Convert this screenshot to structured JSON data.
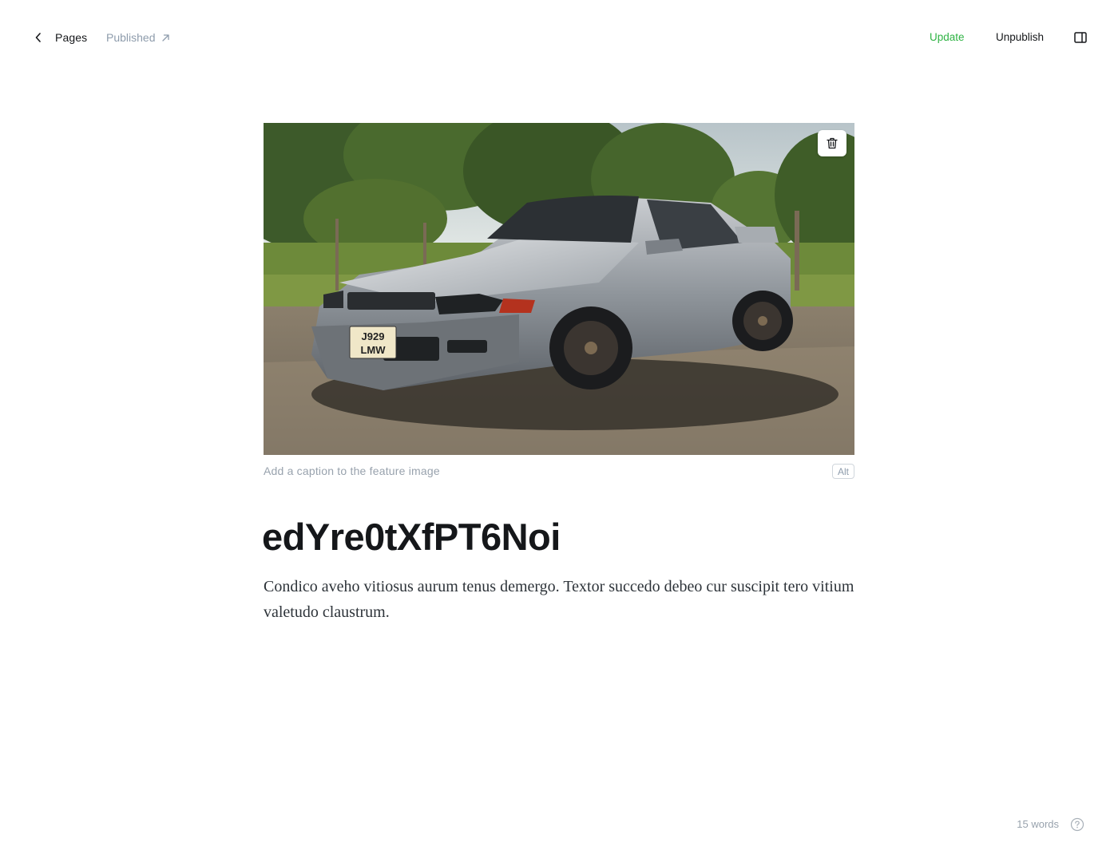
{
  "header": {
    "back_label": "Pages",
    "status_label": "Published",
    "update_label": "Update",
    "unpublish_label": "Unpublish"
  },
  "feature_image": {
    "caption_placeholder": "Add a caption to the feature image",
    "alt_label": "Alt",
    "plate_line1": "J929",
    "plate_line2": "LMW"
  },
  "post": {
    "title": "edYre0tXfPT6Noi",
    "body": "Condico aveho vitiosus aurum tenus demergo. Textor succedo debeo cur suscipit tero vitium valetudo claustrum."
  },
  "footer": {
    "word_count": "15 words"
  },
  "colors": {
    "accent_green": "#2fb344",
    "text_dark": "#15171a",
    "text_muted": "#98a2ad"
  },
  "icons": {
    "back": "chevron-left-icon",
    "status_link": "arrow-up-right-icon",
    "sidebar": "sidebar-toggle-icon",
    "delete": "trash-icon",
    "help": "question-circle-icon"
  }
}
